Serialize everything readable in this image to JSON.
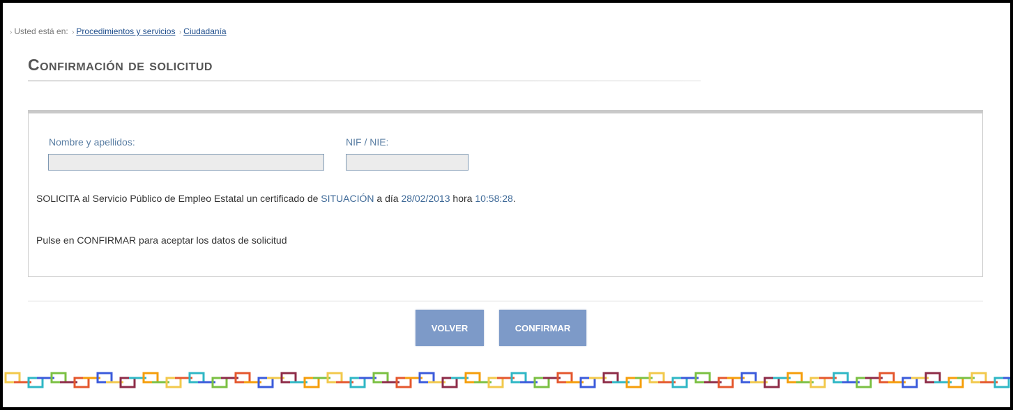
{
  "breadcrumb": {
    "prefix": "Usted está en:",
    "items": [
      "Procedimientos y servicios",
      "Ciudadanía"
    ]
  },
  "page_title": "Confirmación de solicitud",
  "form": {
    "name_label": "Nombre y apellidos:",
    "name_value": "",
    "nif_label": "NIF / NIE:",
    "nif_value": ""
  },
  "request": {
    "text_1": "SOLICITA al Servicio Público de Empleo Estatal un certificado de ",
    "certificate_type": "SITUACIÓN",
    "text_2": " a día ",
    "date": "28/02/2013",
    "text_3": " hora ",
    "time": "10:58:28",
    "text_4": "."
  },
  "confirm_hint": "Pulse en CONFIRMAR para aceptar los datos de solicitud",
  "buttons": {
    "back_label": "VOLVER",
    "confirm_label": "CONFIRMAR"
  },
  "colors": {
    "button": "#7d9ac8",
    "link": "#1f4e8c",
    "highlight": "#3f6a98",
    "chain": [
      "#f2c94c",
      "#2fb7c5",
      "#7bc043",
      "#e4572e",
      "#3b5bdb",
      "#8e2c48",
      "#f59e0b"
    ]
  }
}
